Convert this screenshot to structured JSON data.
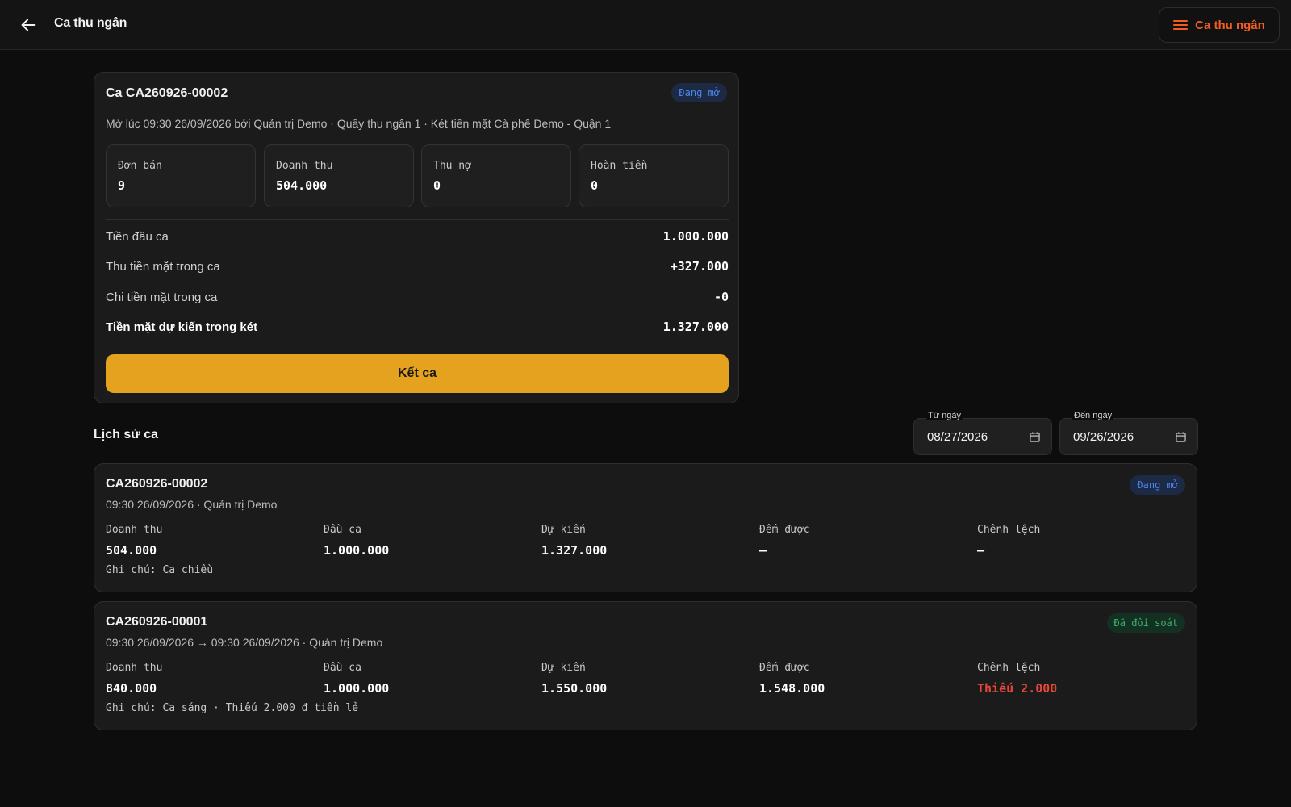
{
  "header": {
    "title": "Ca thu ngân",
    "menu_label": "Ca thu ngân"
  },
  "current_shift": {
    "title": "Ca CA260926-00002",
    "status": "Đang mở",
    "subtitle": "Mở lúc 09:30 26/09/2026 bởi Quản trị Demo · Quầy thu ngân 1 · Két tiền mặt Cà phê Demo - Quận 1",
    "stats": [
      {
        "label": "Đơn bán",
        "value": "9"
      },
      {
        "label": "Doanh thu",
        "value": "504.000"
      },
      {
        "label": "Thu nợ",
        "value": "0"
      },
      {
        "label": "Hoàn tiền",
        "value": "0"
      }
    ],
    "lines": [
      {
        "label": "Tiền đầu ca",
        "value": "1.000.000"
      },
      {
        "label": "Thu tiền mặt trong ca",
        "value": "+327.000"
      },
      {
        "label": "Chi tiền mặt trong ca",
        "value": "-0"
      },
      {
        "label": "Tiền mặt dự kiến trong két",
        "value": "1.327.000"
      }
    ],
    "close_button": "Kết ca"
  },
  "history": {
    "title": "Lịch sử ca",
    "from_label": "Từ ngày",
    "from_value": "08/27/2026",
    "to_label": "Đến ngày",
    "to_value": "09/26/2026",
    "shifts": [
      {
        "id": "CA260926-00002",
        "subtitle": "09:30 26/09/2026 · Quản trị Demo",
        "status": "Đang mở",
        "metrics": [
          {
            "label": "Doanh thu",
            "value": "504.000"
          },
          {
            "label": "Đầu ca",
            "value": "1.000.000"
          },
          {
            "label": "Dự kiến",
            "value": "1.327.000"
          },
          {
            "label": "Đếm được",
            "value": "—"
          },
          {
            "label": "Chênh lệch",
            "value": "—"
          }
        ],
        "note": "Ghi chú: Ca chiều"
      },
      {
        "id": "CA260926-00001",
        "subtitle": "09:30 26/09/2026 → 09:30 26/09/2026 · Quản trị Demo",
        "status": "Đã đối soát",
        "metrics": [
          {
            "label": "Doanh thu",
            "value": "840.000"
          },
          {
            "label": "Đầu ca",
            "value": "1.000.000"
          },
          {
            "label": "Dự kiến",
            "value": "1.550.000"
          },
          {
            "label": "Đếm được",
            "value": "1.548.000"
          },
          {
            "label": "Chênh lệch",
            "value": "Thiếu 2.000"
          }
        ],
        "note": "Ghi chú: Ca sáng · Thiếu 2.000 đ tiền lẻ"
      }
    ]
  },
  "colors": {
    "accent": "#e5a21f",
    "menu_text": "#f45d22",
    "open_badge": "#4d87e8",
    "done_badge": "#3fb26b",
    "danger": "#e5483b"
  }
}
